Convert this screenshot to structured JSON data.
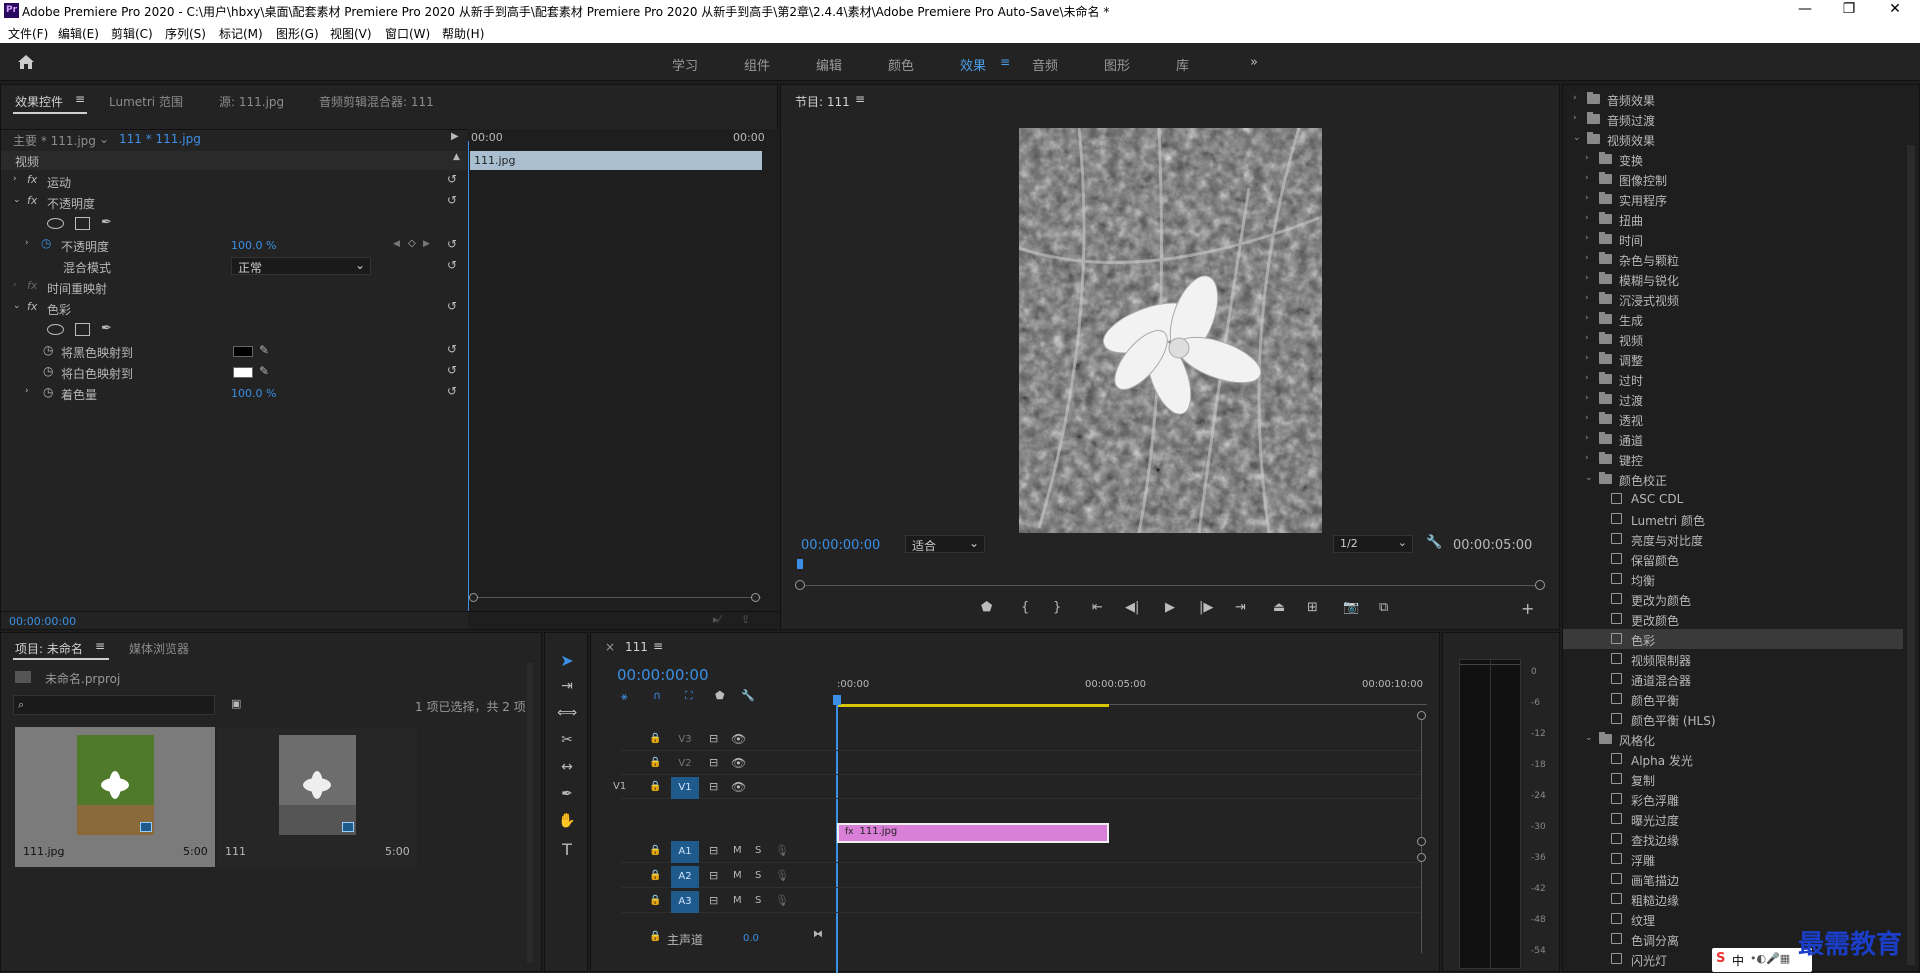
{
  "window": {
    "title": "Adobe Premiere Pro 2020 - C:\\用户\\hbxy\\桌面\\配套素材 Premiere Pro 2020 从新手到高手\\配套素材 Premiere Pro 2020 从新手到高手\\第2章\\2.4.4\\素材\\Adobe Premiere Pro Auto-Save\\未命名 *",
    "logo": "Pr"
  },
  "menu": [
    "文件(F)",
    "编辑(E)",
    "剪辑(C)",
    "序列(S)",
    "标记(M)",
    "图形(G)",
    "视图(V)",
    "窗口(W)",
    "帮助(H)"
  ],
  "workspaces": [
    "学习",
    "组件",
    "编辑",
    "颜色",
    "效果",
    "音频",
    "图形",
    "库"
  ],
  "active_workspace": "效果",
  "effect_controls": {
    "tabs": [
      "效果控件",
      "Lumetri 范围",
      "源: 111.jpg",
      "音频剪辑混合器: 111"
    ],
    "master": "主要 * 111.jpg",
    "clip": "111 * 111.jpg",
    "ruler_start": "00:00",
    "ruler_end": "00:00",
    "clip_bar": "111.jpg",
    "section": "视频",
    "motion": "运动",
    "opacity": "不透明度",
    "opacity_param": "不透明度",
    "opacity_value": "100.0 %",
    "blend_label": "混合模式",
    "blend_value": "正常",
    "time_remap": "时间重映射",
    "tint": "色彩",
    "map_black": "将黑色映射到",
    "map_white": "将白色映射到",
    "amount_tint": "着色量",
    "amount_value": "100.0 %",
    "timecode": "00:00:00:00",
    "fx": "fx"
  },
  "program": {
    "title": "节目: 111",
    "timecode": "00:00:00:00",
    "fit": "适合",
    "quality": "1/2",
    "duration": "00:00:05:00"
  },
  "effects": {
    "items": [
      {
        "label": "音频效果",
        "type": "folder",
        "level": 0,
        "arrow": "›"
      },
      {
        "label": "音频过渡",
        "type": "folder",
        "level": 0,
        "arrow": "›"
      },
      {
        "label": "视频效果",
        "type": "folder",
        "level": 0,
        "arrow": "⌄"
      },
      {
        "label": "变换",
        "type": "folder",
        "level": 1,
        "arrow": "›"
      },
      {
        "label": "图像控制",
        "type": "folder",
        "level": 1,
        "arrow": "›"
      },
      {
        "label": "实用程序",
        "type": "folder",
        "level": 1,
        "arrow": "›"
      },
      {
        "label": "扭曲",
        "type": "folder",
        "level": 1,
        "arrow": "›"
      },
      {
        "label": "时间",
        "type": "folder",
        "level": 1,
        "arrow": "›"
      },
      {
        "label": "杂色与颗粒",
        "type": "folder",
        "level": 1,
        "arrow": "›"
      },
      {
        "label": "模糊与锐化",
        "type": "folder",
        "level": 1,
        "arrow": "›"
      },
      {
        "label": "沉浸式视频",
        "type": "folder",
        "level": 1,
        "arrow": "›"
      },
      {
        "label": "生成",
        "type": "folder",
        "level": 1,
        "arrow": "›"
      },
      {
        "label": "视频",
        "type": "folder",
        "level": 1,
        "arrow": "›"
      },
      {
        "label": "调整",
        "type": "folder",
        "level": 1,
        "arrow": "›"
      },
      {
        "label": "过时",
        "type": "folder",
        "level": 1,
        "arrow": "›"
      },
      {
        "label": "过渡",
        "type": "folder",
        "level": 1,
        "arrow": "›"
      },
      {
        "label": "透视",
        "type": "folder",
        "level": 1,
        "arrow": "›"
      },
      {
        "label": "通道",
        "type": "folder",
        "level": 1,
        "arrow": "›"
      },
      {
        "label": "键控",
        "type": "folder",
        "level": 1,
        "arrow": "›"
      },
      {
        "label": "颜色校正",
        "type": "folder",
        "level": 1,
        "arrow": "⌄"
      },
      {
        "label": "ASC CDL",
        "type": "effect",
        "level": 2,
        "arrow": ""
      },
      {
        "label": "Lumetri 颜色",
        "type": "effect",
        "level": 2,
        "arrow": ""
      },
      {
        "label": "亮度与对比度",
        "type": "effect",
        "level": 2,
        "arrow": ""
      },
      {
        "label": "保留颜色",
        "type": "effect",
        "level": 2,
        "arrow": ""
      },
      {
        "label": "均衡",
        "type": "effect",
        "level": 2,
        "arrow": ""
      },
      {
        "label": "更改为颜色",
        "type": "effect",
        "level": 2,
        "arrow": ""
      },
      {
        "label": "更改颜色",
        "type": "effect",
        "level": 2,
        "arrow": ""
      },
      {
        "label": "色彩",
        "type": "effect",
        "level": 2,
        "arrow": "",
        "selected": true
      },
      {
        "label": "视频限制器",
        "type": "effect",
        "level": 2,
        "arrow": ""
      },
      {
        "label": "通道混合器",
        "type": "effect",
        "level": 2,
        "arrow": ""
      },
      {
        "label": "颜色平衡",
        "type": "effect",
        "level": 2,
        "arrow": ""
      },
      {
        "label": "颜色平衡 (HLS)",
        "type": "effect",
        "level": 2,
        "arrow": ""
      },
      {
        "label": "风格化",
        "type": "folder",
        "level": 1,
        "arrow": "⌄"
      },
      {
        "label": "Alpha 发光",
        "type": "effect",
        "level": 2,
        "arrow": ""
      },
      {
        "label": "复制",
        "type": "effect",
        "level": 2,
        "arrow": ""
      },
      {
        "label": "彩色浮雕",
        "type": "effect",
        "level": 2,
        "arrow": ""
      },
      {
        "label": "曝光过度",
        "type": "effect",
        "level": 2,
        "arrow": ""
      },
      {
        "label": "查找边缘",
        "type": "effect",
        "level": 2,
        "arrow": ""
      },
      {
        "label": "浮雕",
        "type": "effect",
        "level": 2,
        "arrow": ""
      },
      {
        "label": "画笔描边",
        "type": "effect",
        "level": 2,
        "arrow": ""
      },
      {
        "label": "粗糙边缘",
        "type": "effect",
        "level": 2,
        "arrow": ""
      },
      {
        "label": "纹理",
        "type": "effect",
        "level": 2,
        "arrow": ""
      },
      {
        "label": "色调分离",
        "type": "effect",
        "level": 2,
        "arrow": ""
      },
      {
        "label": "闪光灯",
        "type": "effect",
        "level": 2,
        "arrow": ""
      }
    ]
  },
  "project": {
    "tabs": [
      "项目: 未命名",
      "媒体浏览器"
    ],
    "file": "未命名.prproj",
    "selection": "1 项已选择，共 2 项",
    "thumbs": [
      {
        "name": "111.jpg",
        "dur": "5:00"
      },
      {
        "name": "111",
        "dur": "5:00"
      }
    ]
  },
  "timeline": {
    "tab": "111",
    "timecode": "00:00:00:00",
    "ruler": [
      ":00:00",
      "00:00:05:00",
      "00:00:10:00"
    ],
    "video_tracks": [
      "V3",
      "V2",
      "V1"
    ],
    "audio_tracks": [
      "A1",
      "A2",
      "A3"
    ],
    "source_patch": "V1",
    "clip": "111.jpg",
    "master": "主声道",
    "master_value": "0.0",
    "m": "M",
    "s": "S"
  },
  "meter": {
    "ticks": [
      "0",
      "-6",
      "-12",
      "-18",
      "-24",
      "-30",
      "-36",
      "-42",
      "-48",
      "-54"
    ]
  },
  "watermark": {
    "text": "最需教育"
  },
  "ime": {
    "text": "中"
  },
  "colors": {
    "accent": "#3b8fe4",
    "clip": "#d97fd8",
    "tint_black": "#000000",
    "tint_white": "#ffffff"
  }
}
